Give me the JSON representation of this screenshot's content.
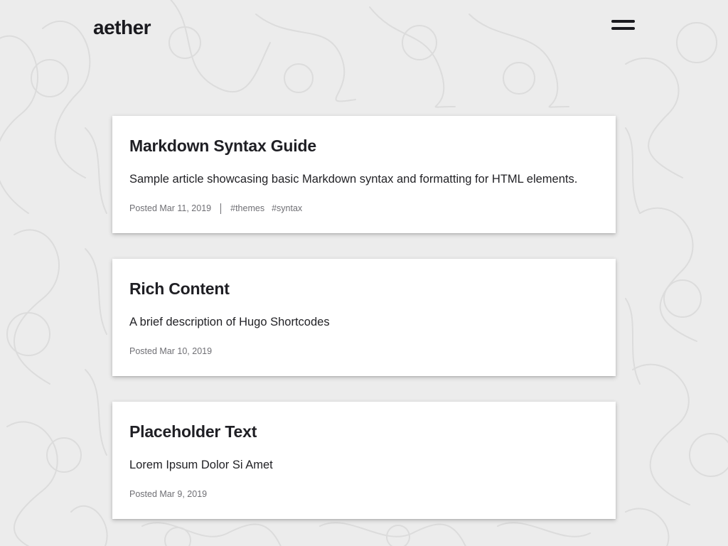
{
  "header": {
    "site_title": "aether",
    "menu_icon": "hamburger-menu-icon"
  },
  "posts": [
    {
      "title": "Markdown Syntax Guide",
      "summary": "Sample article showcasing basic Markdown syntax and formatting for HTML elements.",
      "posted": "Posted Mar 11, 2019",
      "tags": [
        "#themes",
        "#syntax"
      ]
    },
    {
      "title": "Rich Content",
      "summary": "A brief description of Hugo Shortcodes",
      "posted": "Posted Mar 10, 2019",
      "tags": []
    },
    {
      "title": "Placeholder Text",
      "summary": "Lorem Ipsum Dolor Si Amet",
      "posted": "Posted Mar 9, 2019",
      "tags": []
    }
  ],
  "colors": {
    "background": "#ececec",
    "card": "#ffffff",
    "text": "#1f1f24",
    "meta": "#6f6f74"
  }
}
